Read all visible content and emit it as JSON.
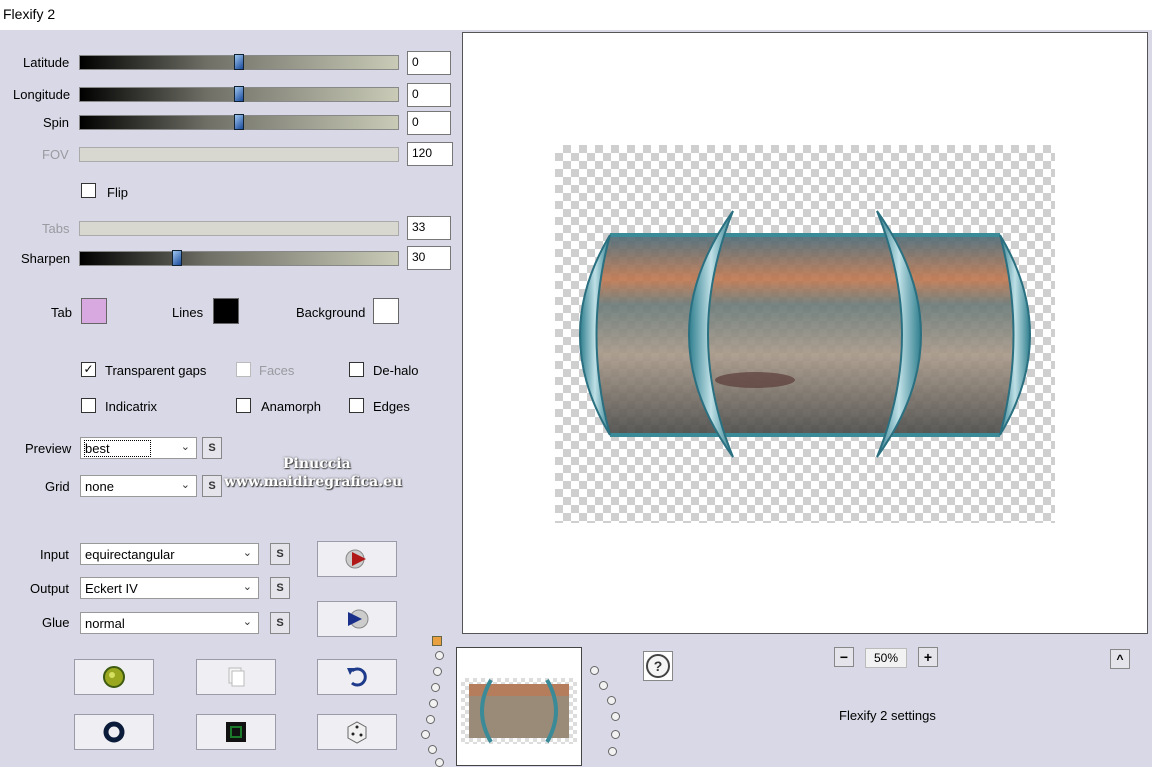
{
  "window": {
    "title": "Flexify 2"
  },
  "sliders": [
    {
      "label": "Latitude",
      "value": "0",
      "enabled": true,
      "position": 0.5
    },
    {
      "label": "Longitude",
      "value": "0",
      "enabled": true,
      "position": 0.5
    },
    {
      "label": "Spin",
      "value": "0",
      "enabled": true,
      "position": 0.5
    },
    {
      "label": "FOV",
      "value": "120",
      "enabled": false
    },
    {
      "label": "Tabs",
      "value": "33",
      "enabled": false
    },
    {
      "label": "Sharpen",
      "value": "30",
      "enabled": true,
      "position": 0.3
    }
  ],
  "flip": {
    "label": "Flip",
    "checked": false
  },
  "colors": {
    "tab_label": "Tab",
    "tab_color": "#d8a8e0",
    "lines_label": "Lines",
    "lines_color": "#000000",
    "background_label": "Background",
    "background_color": "#ffffff"
  },
  "options": {
    "transparent_gaps": {
      "label": "Transparent gaps",
      "checked": true
    },
    "faces": {
      "label": "Faces",
      "checked": false,
      "enabled": false
    },
    "dehalo": {
      "label": "De-halo",
      "checked": false
    },
    "indicatrix": {
      "label": "Indicatrix",
      "checked": false
    },
    "anamorph": {
      "label": "Anamorph",
      "checked": false
    },
    "edges": {
      "label": "Edges",
      "checked": false
    }
  },
  "preview_select": {
    "label": "Preview",
    "value": "best"
  },
  "grid_select": {
    "label": "Grid",
    "value": "none"
  },
  "input_select": {
    "label": "Input",
    "value": "equirectangular"
  },
  "output_select": {
    "label": "Output",
    "value": "Eckert IV"
  },
  "glue_select": {
    "label": "Glue",
    "value": "normal"
  },
  "seed_button_glyph": "S",
  "watermark": {
    "line1": "Pinuccia",
    "line2": "www.maidiregrafica.eu"
  },
  "zoom": {
    "value": "50%",
    "minus": "−",
    "plus": "+"
  },
  "settings_label": "Flexify 2 settings",
  "help_glyph": "?",
  "collapse_glyph": "^",
  "icons": [
    "play-right-icon",
    "play-left-icon",
    "globe-icon",
    "copy-icon",
    "undo-icon",
    "ring-icon",
    "frame-icon",
    "dice-icon",
    "help-icon"
  ]
}
